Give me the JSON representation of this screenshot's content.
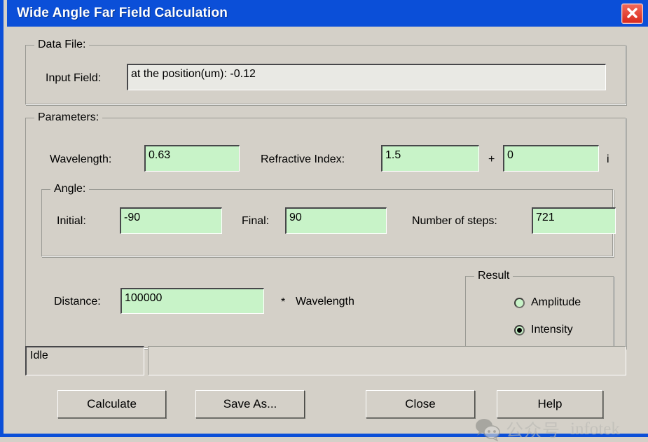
{
  "window": {
    "title": "Wide Angle Far Field Calculation",
    "close_icon": "close-x-icon",
    "titlebar_color": "#0b4fd8",
    "face_color": "#d4d0c8",
    "field_color": "#c8f3c8"
  },
  "data_file": {
    "group_title": "Data File:",
    "input_field_label": "Input Field:",
    "input_field_value": "at the position(um): -0.12"
  },
  "parameters": {
    "group_title": "Parameters:",
    "wavelength_label": "Wavelength:",
    "wavelength_value": "0.63",
    "refractive_index_label": "Refractive Index:",
    "refractive_real_value": "1.5",
    "plus_sign": "+",
    "refractive_imag_value": "0",
    "imaginary_unit": "i",
    "angle": {
      "group_title": "Angle:",
      "initial_label": "Initial:",
      "initial_value": "-90",
      "final_label": "Final:",
      "final_value": "90",
      "steps_label": "Number of steps:",
      "steps_value": "721"
    },
    "distance_label": "Distance:",
    "distance_value": "100000",
    "distance_multiplier": "*",
    "distance_unit": "Wavelength"
  },
  "result": {
    "group_title": "Result",
    "options": [
      {
        "label": "Amplitude",
        "selected": false
      },
      {
        "label": "Intensity",
        "selected": true
      }
    ]
  },
  "status": {
    "text": "Idle",
    "progress_value": ""
  },
  "buttons": {
    "calculate": "Calculate",
    "save_as": "Save As...",
    "close": "Close",
    "help": "Help"
  },
  "watermark": {
    "icon": "wechat-icon",
    "chinese_text": "公众号",
    "english_text": "infotek"
  }
}
